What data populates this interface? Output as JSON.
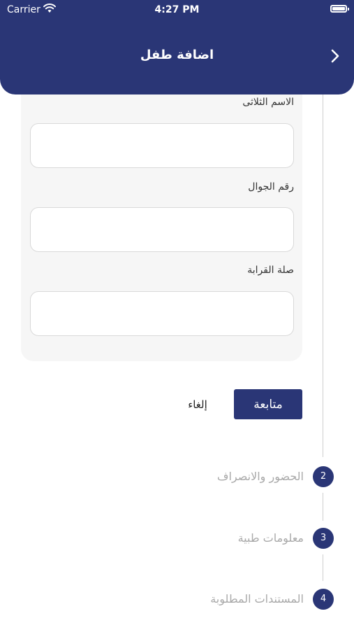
{
  "status_bar": {
    "carrier": "Carrier",
    "time": "4:27 PM"
  },
  "header": {
    "title": "اضافة طفل",
    "back_icon": "chevron-right-icon"
  },
  "form": {
    "fields": [
      {
        "label": "الاسم الثلاثى",
        "value": ""
      },
      {
        "label": "رقم الجوال",
        "value": ""
      },
      {
        "label": "صلة القرابة",
        "value": ""
      }
    ]
  },
  "actions": {
    "continue_label": "متابعة",
    "cancel_label": "إلغاء"
  },
  "steps": [
    {
      "number": "2",
      "label": "الحضور والانصراف"
    },
    {
      "number": "3",
      "label": "معلومات طبية"
    },
    {
      "number": "4",
      "label": "المستندات المطلوبة"
    }
  ],
  "colors": {
    "primary": "#2a3676",
    "card_bg": "#f6f6f6",
    "muted_text": "#a9a9a9"
  }
}
